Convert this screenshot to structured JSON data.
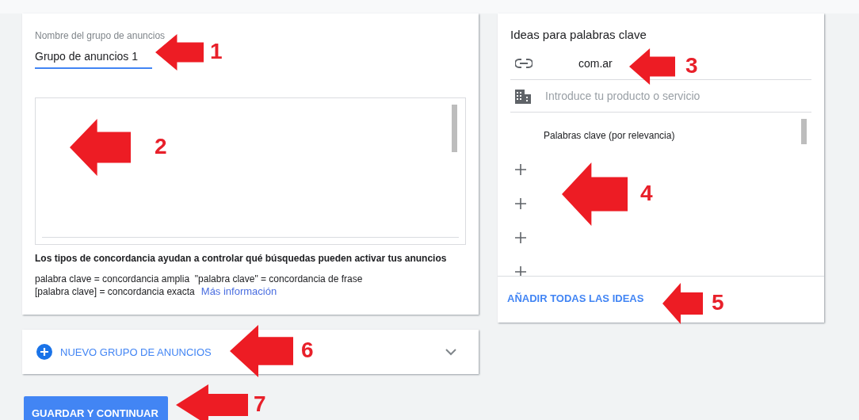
{
  "ad_group": {
    "name_field": {
      "label": "Nombre del grupo de anuncios",
      "value": "Grupo de anuncios 1"
    },
    "match_types": {
      "heading": "Los tipos de concordancia ayudan a controlar qué búsquedas pueden activar tus anuncios",
      "lines": [
        "palabra clave = concordancia amplia  \"palabra clave\" = concordancia de frase",
        "[palabra clave] = concordancia exacta"
      ],
      "link": "Más información"
    }
  },
  "new_group": {
    "label": "NUEVO GRUPO DE ANUNCIOS",
    "expanded": false
  },
  "save_button": "GUARDAR Y CONTINUAR",
  "ideas": {
    "title": "Ideas para palabras clave",
    "url_value": "com.ar",
    "product_placeholder": "Introduce tu producto o servicio",
    "column_header": "Palabras clave (por relevancia)",
    "rows": [
      {
        "kind": "add"
      },
      {
        "kind": "add"
      },
      {
        "kind": "add"
      },
      {
        "kind": "add"
      }
    ],
    "add_all": "AÑADIR TODAS LAS IDEAS"
  },
  "annotations": [
    {
      "number": "1"
    },
    {
      "number": "2"
    },
    {
      "number": "3"
    },
    {
      "number": "4"
    },
    {
      "number": "5"
    },
    {
      "number": "6"
    },
    {
      "number": "7"
    }
  ]
}
